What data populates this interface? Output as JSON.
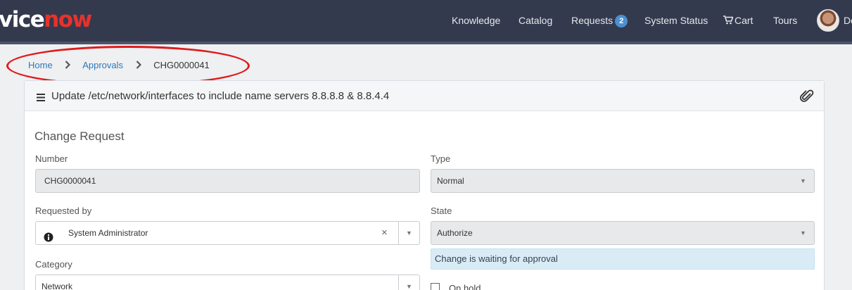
{
  "header": {
    "logo_prefix": "vice",
    "logo_suffix": "now",
    "nav": {
      "knowledge": "Knowledge",
      "catalog": "Catalog",
      "requests": "Requests",
      "requests_count": "2",
      "system_status": "System Status",
      "cart": "Cart",
      "tours": "Tours"
    },
    "user_name": "Do"
  },
  "breadcrumb": {
    "home": "Home",
    "approvals": "Approvals",
    "current": "CHG0000041"
  },
  "card": {
    "title": "Update /etc/network/interfaces to include name servers 8.8.8.8 & 8.8.4.4"
  },
  "form": {
    "section_title": "Change Request",
    "number_label": "Number",
    "number_value": "CHG0000041",
    "type_label": "Type",
    "type_value": "Normal",
    "requested_by_label": "Requested by",
    "requested_by_value": "System Administrator",
    "state_label": "State",
    "state_value": "Authorize",
    "state_message": "Change is waiting for approval",
    "category_label": "Category",
    "category_value": "Network",
    "on_hold_label": "On hold"
  },
  "colors": {
    "header_bg": "#343a4e",
    "accent_red": "#e8322b",
    "link_blue": "#2f78b8",
    "badge_blue": "#4a90d2",
    "info_bg": "#d9ecf6"
  },
  "icons": [
    "menu-icon",
    "paperclip-icon",
    "cart-icon",
    "chevron-right-icon",
    "info-icon",
    "clear-icon",
    "caret-down-icon"
  ]
}
